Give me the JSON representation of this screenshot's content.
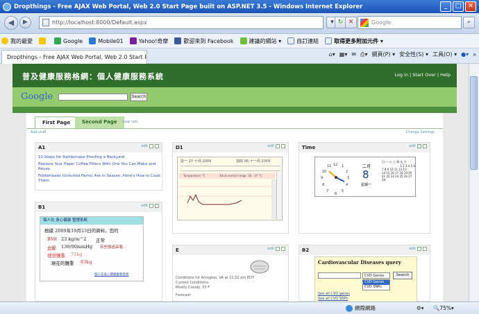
{
  "window": {
    "title": "Dropthings - Free AJAX Web Portal, Web 2.0 Start Page built on ASP.NET 3.5 - Windows Internet Explorer"
  },
  "address": {
    "url": "http://localhost:8000/Default.aspx",
    "search_placeholder": "Google"
  },
  "favorites": {
    "label": "我的最愛",
    "items": [
      "Google",
      "Mobile01",
      "Yahoo!奇摩",
      "歡迎來到 Facebook",
      "建議的網站 ▾",
      "自訂連結",
      "取得更多附加元件 ▾"
    ]
  },
  "browser_tab": {
    "label": "Dropthings - Free AJAX Web Portal, Web 2.0 Start Pag..."
  },
  "command_bar": {
    "page": "網頁(P) ▾",
    "safety": "安全性(S) ▾",
    "tools": "工具(O) ▾"
  },
  "header": {
    "site_title": "普及健康服務格網：個人健康服務系統",
    "links": "Log in | Start Over | Help",
    "google_logo": "Google",
    "search_button": "Search"
  },
  "tabs": {
    "first": "First Page",
    "second": "Second Page",
    "new": "new tab"
  },
  "toolbar": {
    "add_stuff": "Add stuff",
    "change_settings": "Change Settings"
  },
  "widgets": {
    "a1": {
      "title": "A1",
      "edit": "edit",
      "links": [
        "10 Steps for Rattlesnake Proofing a Backyard",
        "Replace Your Paper Coffee Filters With One You Can Make and Reuse:",
        "Fiddleheads (Unfurled Ferns) Are in Season. Here's How to Cook Them:"
      ]
    },
    "b1": {
      "title": "B1",
      "edit": "edit",
      "card_header": "個人化 身心健康 管理系統",
      "line1": "根據 2009年10月23日的資料，您的",
      "bmi_label": "BMI",
      "bmi_value": "23 kg/m^2",
      "bmi_status": "正常",
      "bp_label": "血壓",
      "bp_value": "130/90mmHg",
      "bp_status": "有些微過高喔...",
      "ideal_label": "理想體重",
      "ideal_value": "71kg",
      "current_label": "現在的體重",
      "current_value": "83kg",
      "footer": "個人化身心健康服務系統"
    },
    "d1": {
      "title": "D1",
      "edit": "edit",
      "date_from": "從一 27-十月-2009",
      "date_to": "週四 06-十一月-2009",
      "legend_temp": "Temperature °C",
      "legend_normal": "Adult normal range: 36 - 37 °C"
    },
    "time": {
      "title": "Time",
      "edit": "edit",
      "month": "二月",
      "day": "8",
      "weekday": "星期一",
      "cal_header": "日 一 二 三 四 五 六",
      "cal_rows": [
        "1 2 3 4 5 6",
        "7 8 9 10 11 12 13",
        "14 15 16 17 18 19 20",
        "21 22 23 24 25 26 27",
        "28"
      ]
    },
    "e": {
      "title": "E",
      "edit": "edit",
      "conditions": "Conditions for Arlington, VA at 11:52 pm EDT",
      "current": "Current Conditions:",
      "weather": "Mostly Cloudy, 55 F",
      "forecast": "Forecast:"
    },
    "b2": {
      "title": "B2",
      "edit": "edit",
      "heading": "Cardiovascular Diseases query",
      "select_value": "CVD Genes",
      "search_button": "Search",
      "options": [
        "CVD Genes",
        "CVD SNPs"
      ],
      "link1": "See all CVD genes",
      "link2": "See all CVD SNPs"
    }
  },
  "status": {
    "zone": "網際網路",
    "zoom": "75%"
  }
}
